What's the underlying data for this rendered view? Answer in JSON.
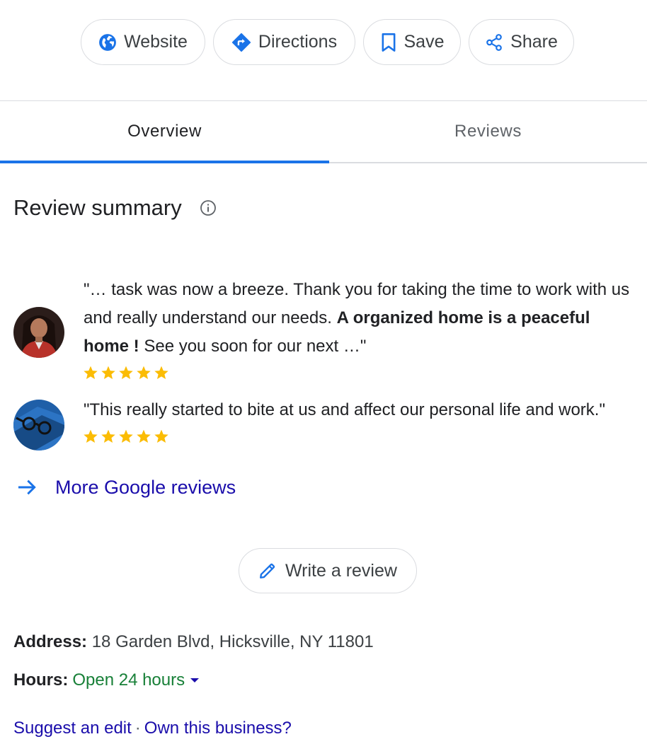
{
  "actions": {
    "website_label": "Website",
    "directions_label": "Directions",
    "save_label": "Save",
    "share_label": "Share"
  },
  "tabs": [
    {
      "label": "Overview",
      "selected": true
    },
    {
      "label": "Reviews",
      "selected": false
    }
  ],
  "review_summary": {
    "title": "Review summary",
    "reviews": [
      {
        "text_before": "\"… task was now a breeze. Thank you for taking the time to work with us and really understand our needs. ",
        "text_bold": "A organized home is a peaceful home !",
        "text_after": " See you soon for our next …\"",
        "rating": 5
      },
      {
        "text": "\"This really started to bite at us and affect our personal life and work.\"",
        "rating": 5
      }
    ],
    "more_reviews_label": "More Google reviews",
    "write_review_label": "Write a review"
  },
  "details": {
    "address_label": "Address:",
    "address_value": "18 Garden Blvd, Hicksville, NY 11801",
    "hours_label": "Hours:",
    "hours_value": "Open 24 hours"
  },
  "footer": {
    "suggest_edit": "Suggest an edit",
    "separator": "·",
    "own_business": "Own this business?"
  },
  "colors": {
    "accent": "#1a73e8",
    "link": "#1a0dab",
    "star": "#fbbc04",
    "open_green": "#188038"
  }
}
